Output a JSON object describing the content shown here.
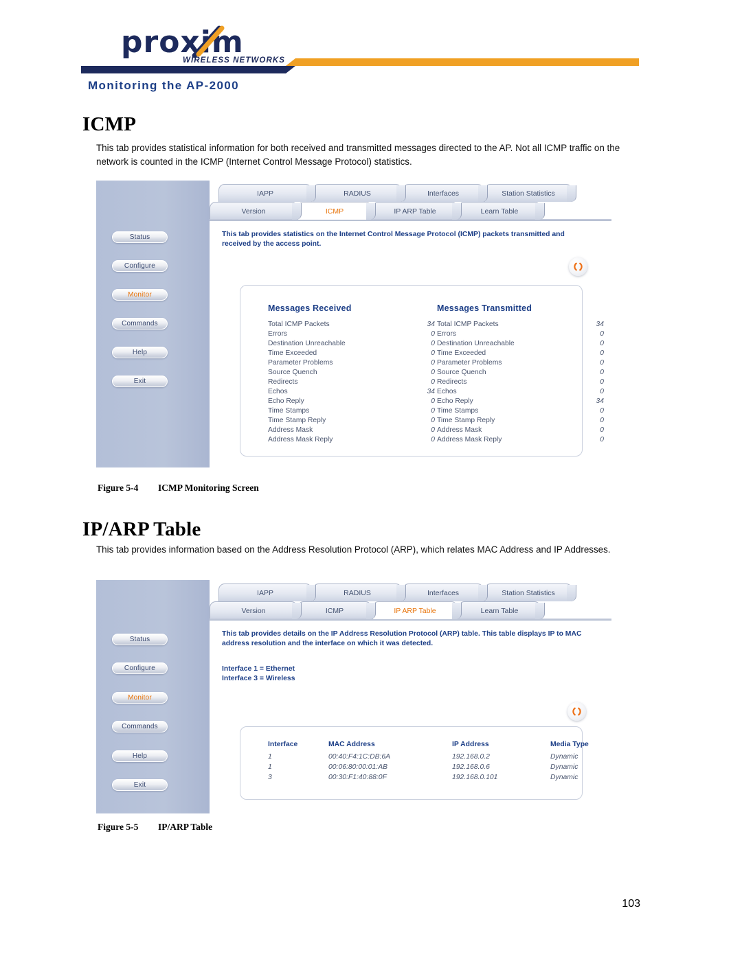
{
  "header": {
    "logo_word": "proxim",
    "logo_tagline": "WIRELESS NETWORKS",
    "chapter_title": "Monitoring the AP-2000",
    "navy_color": "#1d2a5c",
    "orange_color": "#f0a024",
    "heading_blue": "#1d3f87"
  },
  "sections": [
    {
      "heading": "ICMP",
      "paragraph": "This tab provides statistical information for both received and transmitted messages directed to the AP. Not all ICMP traffic on the network is counted in the ICMP (Internet Control Message Protocol) statistics.",
      "figure_label": "Figure 5-4",
      "figure_title": "ICMP Monitoring Screen"
    },
    {
      "heading": "IP/ARP Table",
      "paragraph": "This tab provides information based on the Address Resolution Protocol (ARP), which relates MAC Address and IP Addresses.",
      "figure_label": "Figure 5-5",
      "figure_title": "IP/ARP Table"
    }
  ],
  "app": {
    "sidebar_buttons": [
      "Status",
      "Configure",
      "Monitor",
      "Commands",
      "Help",
      "Exit"
    ],
    "active_sidebar_button": "Monitor",
    "tabs_top": [
      "IAPP",
      "RADIUS",
      "Interfaces",
      "Station Statistics"
    ],
    "tabs_bottom": [
      "Version",
      "ICMP",
      "IP ARP Table",
      "Learn Table"
    ],
    "refresh_icon": "refresh-icon",
    "active_color": "#e8740a"
  },
  "icmp_screen": {
    "active_tab": "ICMP",
    "description": "This tab provides statistics on the Internet Control Message Protocol (ICMP) packets transmitted and received by the access point.",
    "columns": [
      {
        "title": "Messages Received",
        "rows": [
          {
            "label": "Total ICMP Packets",
            "value": "34"
          },
          {
            "label": "Errors",
            "value": "0"
          },
          {
            "label": "Destination Unreachable",
            "value": "0"
          },
          {
            "label": "Time Exceeded",
            "value": "0"
          },
          {
            "label": "Parameter Problems",
            "value": "0"
          },
          {
            "label": "Source Quench",
            "value": "0"
          },
          {
            "label": "Redirects",
            "value": "0"
          },
          {
            "label": "Echos",
            "value": "34"
          },
          {
            "label": "Echo Reply",
            "value": "0"
          },
          {
            "label": "Time Stamps",
            "value": "0"
          },
          {
            "label": "Time Stamp Reply",
            "value": "0"
          },
          {
            "label": "Address Mask",
            "value": "0"
          },
          {
            "label": "Address Mask Reply",
            "value": "0"
          }
        ]
      },
      {
        "title": "Messages Transmitted",
        "rows": [
          {
            "label": "Total ICMP Packets",
            "value": "34"
          },
          {
            "label": "Errors",
            "value": "0"
          },
          {
            "label": "Destination Unreachable",
            "value": "0"
          },
          {
            "label": "Time Exceeded",
            "value": "0"
          },
          {
            "label": "Parameter Problems",
            "value": "0"
          },
          {
            "label": "Source Quench",
            "value": "0"
          },
          {
            "label": "Redirects",
            "value": "0"
          },
          {
            "label": "Echos",
            "value": "0"
          },
          {
            "label": "Echo Reply",
            "value": "34"
          },
          {
            "label": "Time Stamps",
            "value": "0"
          },
          {
            "label": "Time Stamp Reply",
            "value": "0"
          },
          {
            "label": "Address Mask",
            "value": "0"
          },
          {
            "label": "Address Mask Reply",
            "value": "0"
          }
        ]
      }
    ]
  },
  "arp_screen": {
    "active_tab": "IP ARP Table",
    "description": "This tab provides details on the IP Address Resolution Protocol (ARP) table. This table displays IP to MAC address resolution and the interface on which it was detected.",
    "interface_notes": [
      "Interface 1 = Ethernet",
      "Interface 3 = Wireless"
    ],
    "table_headers": [
      "Interface",
      "MAC Address",
      "IP Address",
      "Media Type"
    ],
    "table_rows": [
      {
        "interface": "1",
        "mac": "00:40:F4:1C:DB:6A",
        "ip": "192.168.0.2",
        "media": "Dynamic"
      },
      {
        "interface": "1",
        "mac": "00:06:80:00:01:AB",
        "ip": "192.168.0.6",
        "media": "Dynamic"
      },
      {
        "interface": "3",
        "mac": "00:30:F1:40:88:0F",
        "ip": "192.168.0.101",
        "media": "Dynamic"
      }
    ]
  },
  "footer": {
    "page_number": "103"
  }
}
